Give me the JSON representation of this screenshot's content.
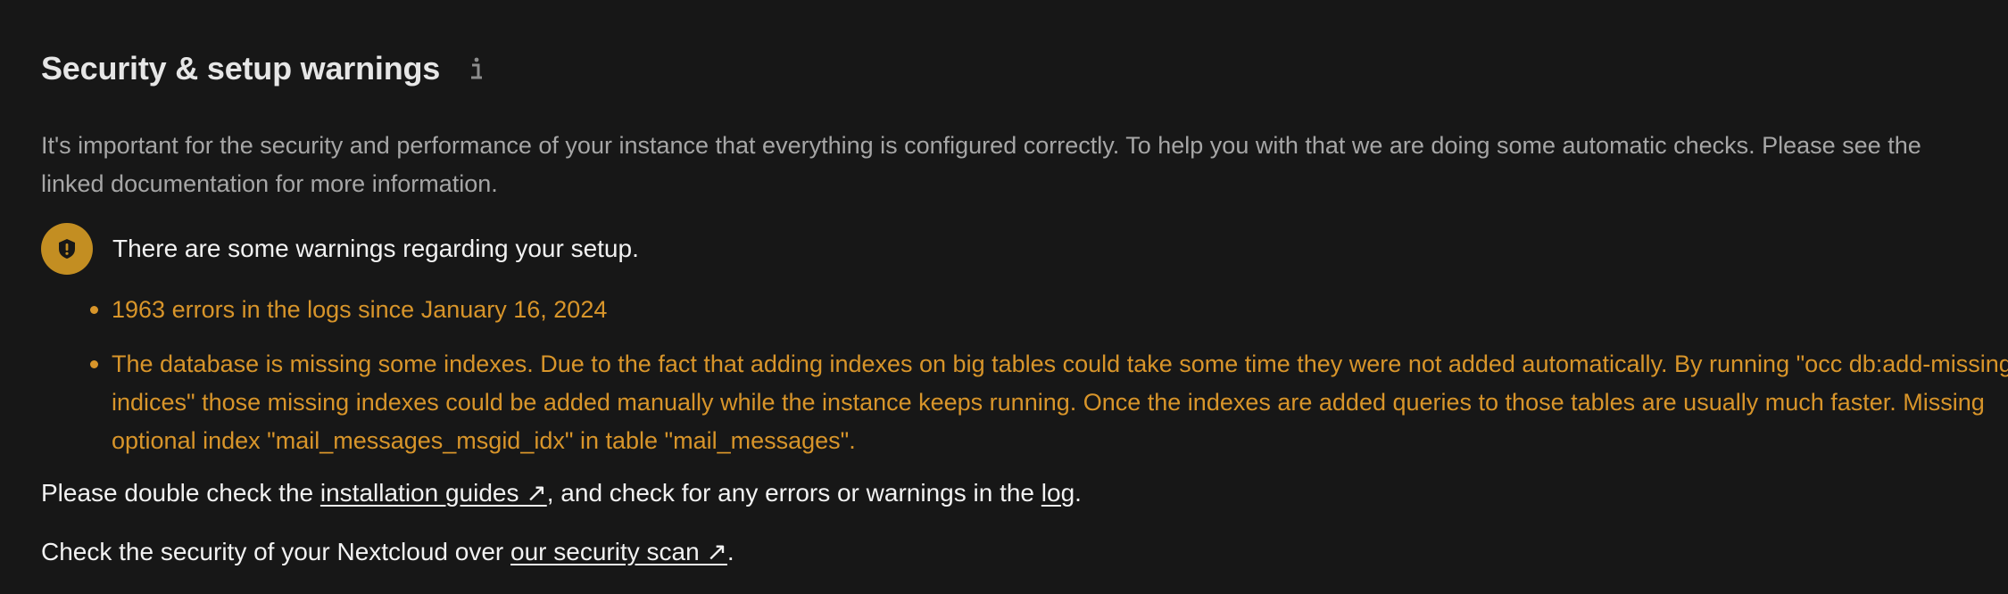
{
  "section": {
    "title": "Security & setup warnings",
    "info_icon": "info-icon",
    "intro": "It's important for the security and performance of your instance that everything is configured correctly. To help you with that we are doing some automatic checks. Please see the linked documentation for more information."
  },
  "warning": {
    "icon": "exclamation-shield-icon",
    "color": "#c38e22",
    "message": "There are some warnings regarding your setup.",
    "items": [
      {
        "text": "1963 errors in the logs since January 16, 2024"
      },
      {
        "text": "The database is missing some indexes. Due to the fact that adding indexes on big tables could take some time they were not added automatically. By running \"occ db:add-missing-indices\" those missing indexes could be added manually while the instance keeps running. Once the indexes are added queries to those tables are usually much faster. Missing optional index \"mail_messages_msgid_idx\" in table \"mail_messages\"."
      }
    ]
  },
  "footer": {
    "check_prefix": "Please double check the ",
    "installation_guides_link": "installation guides ↗",
    "check_middle": ", and check for any errors or warnings in the ",
    "log_link": "log",
    "check_suffix": ".",
    "scan_prefix": "Check the security of your Nextcloud over ",
    "security_scan_link": "our security scan ↗",
    "scan_suffix": "."
  },
  "colors": {
    "background": "#171717",
    "warning_text": "#d8952a",
    "intro_text": "#a6a6a6"
  }
}
